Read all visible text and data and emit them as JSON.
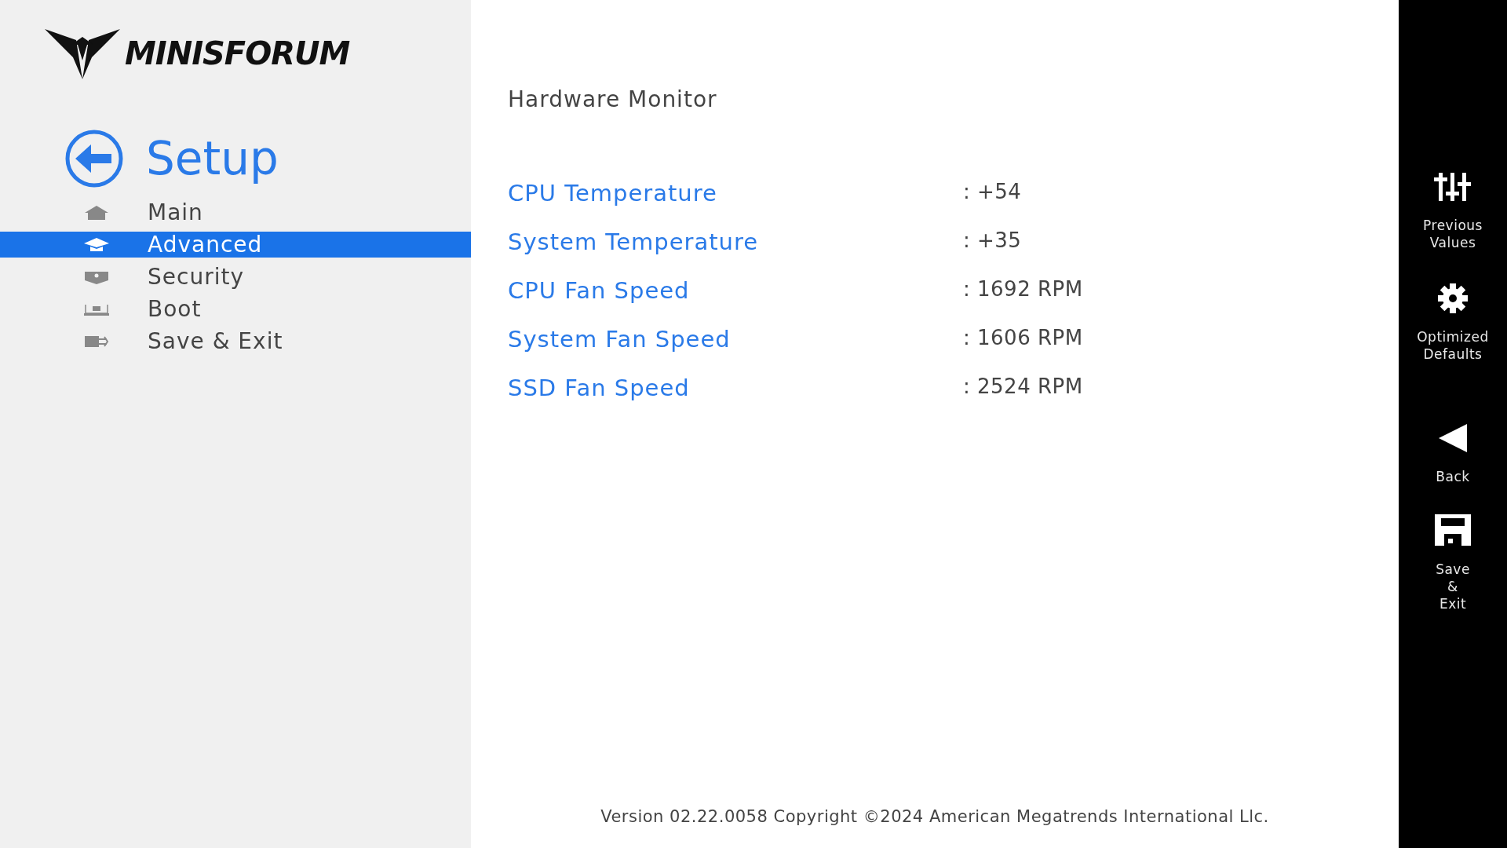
{
  "logo": {
    "text": "MINISFORUM"
  },
  "setup": {
    "title": "Setup"
  },
  "menu": [
    {
      "label": "Main",
      "kind": "home",
      "selected": false
    },
    {
      "label": "Advanced",
      "kind": "advanced",
      "selected": true
    },
    {
      "label": "Security",
      "kind": "security",
      "selected": false
    },
    {
      "label": "Boot",
      "kind": "boot",
      "selected": false
    },
    {
      "label": "Save & Exit",
      "kind": "exit",
      "selected": false
    }
  ],
  "page": {
    "title": "Hardware Monitor",
    "rows": [
      {
        "label": "CPU Temperature",
        "value": ": +54"
      },
      {
        "label": "System Temperature",
        "value": ": +35"
      },
      {
        "label": "CPU Fan Speed",
        "value": ": 1692 RPM"
      },
      {
        "label": "System Fan Speed",
        "value": ": 1606 RPM"
      },
      {
        "label": "SSD Fan Speed",
        "value": ": 2524 RPM"
      }
    ]
  },
  "footer": "Version 02.22.0058 Copyright ©2024 American Megatrends International Llc.",
  "actions": [
    {
      "label": "Previous Values",
      "kind": "sliders"
    },
    {
      "label": "Optimized Defaults",
      "kind": "gear"
    },
    {
      "label": "Back",
      "kind": "back"
    },
    {
      "label": "Save & Exit",
      "kind": "save"
    }
  ]
}
